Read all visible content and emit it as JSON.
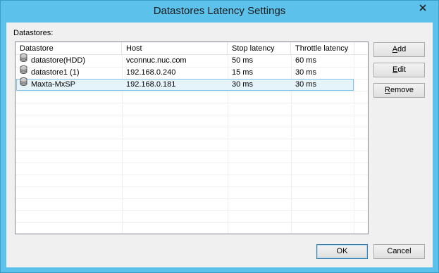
{
  "window": {
    "title": "Datastores Latency Settings"
  },
  "datastores_label": "Datastores:",
  "columns": [
    "Datastore",
    "Host",
    "Stop latency",
    "Throttle latency"
  ],
  "rows": [
    {
      "datastore": "datastore(HDD)",
      "host": "vconnuc.nuc.com",
      "stop": "50 ms",
      "throttle": "60 ms",
      "selected": false
    },
    {
      "datastore": "datastore1 (1)",
      "host": "192.168.0.240",
      "stop": "15 ms",
      "throttle": "30 ms",
      "selected": false
    },
    {
      "datastore": "Maxta-MxSP",
      "host": "192.168.0.181",
      "stop": "30 ms",
      "throttle": "30 ms",
      "selected": true
    }
  ],
  "buttons": {
    "add": {
      "mnemonic": "A",
      "rest": "dd"
    },
    "edit": {
      "mnemonic": "E",
      "rest": "dit"
    },
    "remove": {
      "mnemonic": "R",
      "rest": "emove"
    },
    "ok": "OK",
    "cancel": "Cancel"
  },
  "icons": {
    "close": "close-icon",
    "datastore": "database-icon"
  },
  "colors": {
    "titlebar": "#5cc2ec",
    "selection": "#e5f3fb",
    "selection_border": "#7fc2ea"
  }
}
